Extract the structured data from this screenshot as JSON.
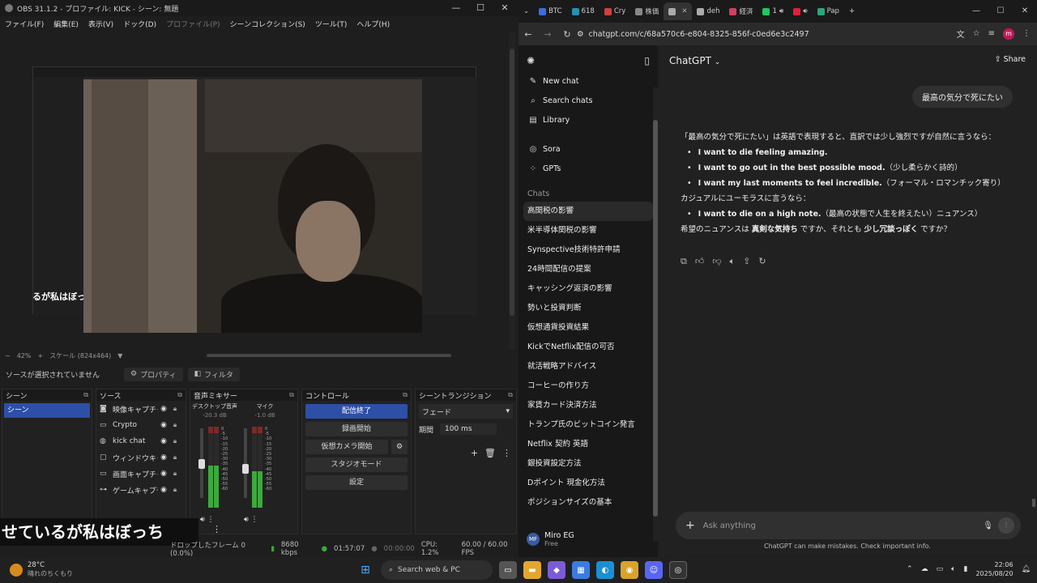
{
  "obs": {
    "title": "OBS 31.1.2 - プロファイル: KICK - シーン: 無題",
    "window_controls": [
      "—",
      "☐",
      "✕"
    ],
    "menu": [
      "ファイル(F)",
      "編集(E)",
      "表示(V)",
      "ドック(D)",
      "プロファイル(P)",
      "シーンコレクション(S)",
      "ツール(T)",
      "ヘルプ(H)"
    ],
    "nested_text": "るが私はぼっち",
    "zoom": "42%",
    "scale": "スケール (824x464)",
    "no_source": "ソースが選択されていません",
    "properties": "プロパティ",
    "filters": "フィルタ",
    "docks": {
      "scenes": {
        "title": "シーン",
        "items": [
          "シーン"
        ]
      },
      "sources": {
        "title": "ソース",
        "items": [
          {
            "name": "映像キャプチャデ",
            "icon": "camera-icon"
          },
          {
            "name": "Crypto",
            "icon": "display-icon"
          },
          {
            "name": "kick chat",
            "icon": "globe-icon"
          },
          {
            "name": "ウィンドウキャプ",
            "icon": "window-icon"
          },
          {
            "name": "画面キャプチャ",
            "icon": "monitor-icon"
          },
          {
            "name": "ゲームキャプチャ",
            "icon": "gamepad-icon"
          }
        ]
      },
      "mixer": {
        "title": "音声ミキサー",
        "channels": [
          {
            "name": "デスクトップ音声",
            "db": "-20.3 dB",
            "level": 0.52
          },
          {
            "name": "マイク",
            "db": "-1.0 dB",
            "level": 0.45
          }
        ],
        "ticks": [
          "0",
          "-5",
          "-10",
          "-15",
          "-20",
          "-25",
          "-30",
          "-35",
          "-40",
          "-45",
          "-50",
          "-55",
          "-60"
        ]
      },
      "controls": {
        "title": "コントロール",
        "buttons": [
          "配信終了",
          "録画開始",
          "仮想カメラ開始",
          "スタジオモード",
          "設定"
        ]
      },
      "transitions": {
        "title": "シーントランジション",
        "selected": "フェード",
        "duration_label": "期間",
        "duration_value": "100 ms"
      }
    },
    "subtitle": "せているが私はぼっち",
    "status": {
      "dropped": "ドロップしたフレーム 0 (0.0%)",
      "kbps": "8680 kbps",
      "stream_time": "01:57:07",
      "rec_time": "00:00:00",
      "cpu": "CPU: 1.2%",
      "fps": "60.00 / 60.00 FPS"
    }
  },
  "browser": {
    "tabs": [
      {
        "label": "BTC",
        "color": "#3a6de0"
      },
      {
        "label": "618",
        "color": "#2a8fb0"
      },
      {
        "label": "Cry",
        "color": "#d04040"
      },
      {
        "label": "株価",
        "color": "#888888"
      },
      {
        "label": "",
        "color": "#aaaaaa",
        "active": true
      },
      {
        "label": "deh",
        "color": "#aaaaaa"
      },
      {
        "label": "経済",
        "color": "#d04060"
      },
      {
        "label": "1",
        "color": "#22c55e"
      },
      {
        "label": "",
        "color": "#e0203a"
      },
      {
        "label": "Pap",
        "color": "#2ea37a"
      }
    ],
    "url": "chatgpt.com/c/68a570c6-e804-8325-856f-c0ed6e3c2497",
    "avatar": "m",
    "sidebar": {
      "nav": [
        {
          "label": "New chat",
          "icon": "✎"
        },
        {
          "label": "Search chats",
          "icon": "⌕"
        },
        {
          "label": "Library",
          "icon": "▤"
        }
      ],
      "nav2": [
        {
          "label": "Sora",
          "icon": "◎"
        },
        {
          "label": "GPTs",
          "icon": "⁘"
        }
      ],
      "chats_header": "Chats",
      "chats": [
        "高関税の影響",
        "米半導体関税の影響",
        "Synspective技術特許申請",
        "24時間配信の提案",
        "キャッシング返済の影響",
        "勢いと投資判断",
        "仮想通貨投資結果",
        "KickでNetflix配信の可否",
        "就活戦略アドバイス",
        "コーヒーの作り方",
        "家賃カード決済方法",
        "トランプ氏のビットコイン発言",
        "Netflix 契約 英語",
        "銀投資設定方法",
        "Dポイント 現金化方法",
        "ポジションサイズの基本"
      ],
      "user_name": "Miro EG",
      "user_plan": "Free",
      "user_initials": "MF"
    },
    "main": {
      "model": "ChatGPT",
      "share": "Share",
      "user_message": "最高の気分で死にたい",
      "intro": "「最高の気分で死にたい」は英語で表現すると、直訳では少し強烈ですが自然に言うなら：",
      "list1": [
        {
          "en": "I want to die feeling amazing.",
          "jp": ""
        },
        {
          "en": "I want to go out in the best possible mood.",
          "jp": "（少し柔らかく詩的）"
        },
        {
          "en": "I want my last moments to feel incredible.",
          "jp": "（フォーマル・ロマンチック寄り）"
        }
      ],
      "casual": "カジュアルにユーモラスに言うなら：",
      "list2": [
        {
          "en": "I want to die on a high note.",
          "jp": "（最高の状態で人生を終えたい）ニュアンス）"
        }
      ],
      "question": {
        "p1": "希望のニュアンスは ",
        "b1": "真剣な気持ち",
        "p2": " ですか、それとも ",
        "b2": "少し冗談っぽく",
        "p3": " ですか？"
      },
      "composer_placeholder": "Ask anything",
      "disclaimer": "ChatGPT can make mistakes. Check important info."
    }
  },
  "taskbar": {
    "temp": "28°C",
    "weather": "晴れのちくもり",
    "search": "Search web & PC",
    "time": "22:06",
    "date": "2025/08/20"
  }
}
